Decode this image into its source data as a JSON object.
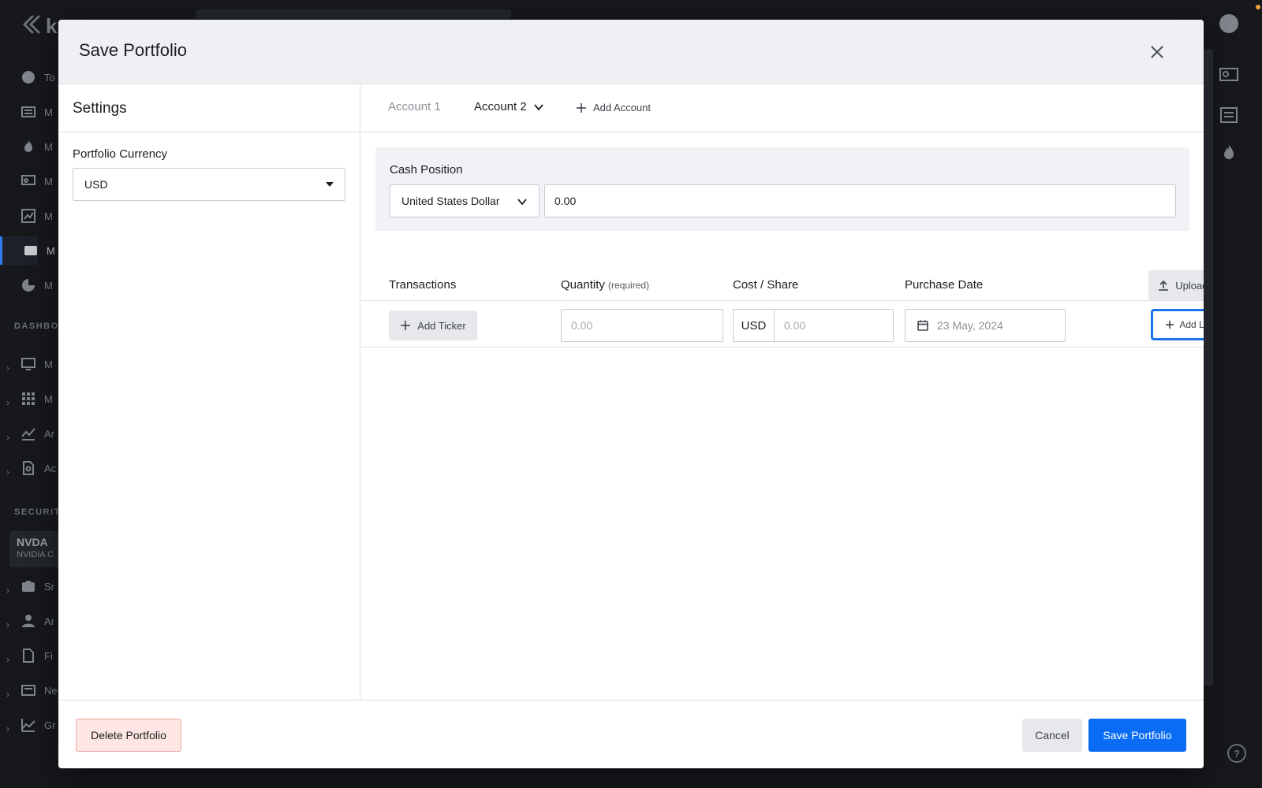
{
  "background": {
    "logo_text": "k",
    "nav_labels": [
      "To",
      "M",
      "M",
      "M",
      "M",
      "M",
      "M"
    ],
    "section_dashboards": "DASHBOA",
    "dashboard_labels": [
      "M",
      "M",
      "Ar",
      "Ac"
    ],
    "section_securities": "SECURITI",
    "ticker_symbol": "NVDA",
    "ticker_name": "NVIDIA C",
    "security_labels": [
      "Sr",
      "Ar",
      "Fi",
      "Ne",
      "Gr"
    ],
    "help_label": "?"
  },
  "modal": {
    "title": "Save Portfolio",
    "settings": {
      "title": "Settings",
      "currency_label": "Portfolio Currency",
      "currency_value": "USD"
    },
    "tabs": {
      "account1": "Account 1",
      "account2": "Account 2",
      "add_account": "Add Account"
    },
    "cash": {
      "label": "Cash Position",
      "currency": "United States Dollar",
      "amount": "0.00"
    },
    "table": {
      "col_transactions": "Transactions",
      "col_quantity": "Quantity",
      "col_quantity_note": "(required)",
      "col_cost": "Cost / Share",
      "col_date": "Purchase Date",
      "upload_csv": "Upload CSV"
    },
    "row": {
      "add_ticker": "Add Ticker",
      "quantity_placeholder": "0.00",
      "cost_currency": "USD",
      "cost_placeholder": "0.00",
      "date_placeholder": "23 May, 2024",
      "add_lot": "Add Lot"
    },
    "footer": {
      "delete": "Delete Portfolio",
      "cancel": "Cancel",
      "save": "Save Portfolio"
    }
  },
  "colors": {
    "primary": "#0a6cf5",
    "focus_ring": "#1a73e8",
    "danger_bg": "#fde6e4",
    "backdrop": "#16181c"
  }
}
